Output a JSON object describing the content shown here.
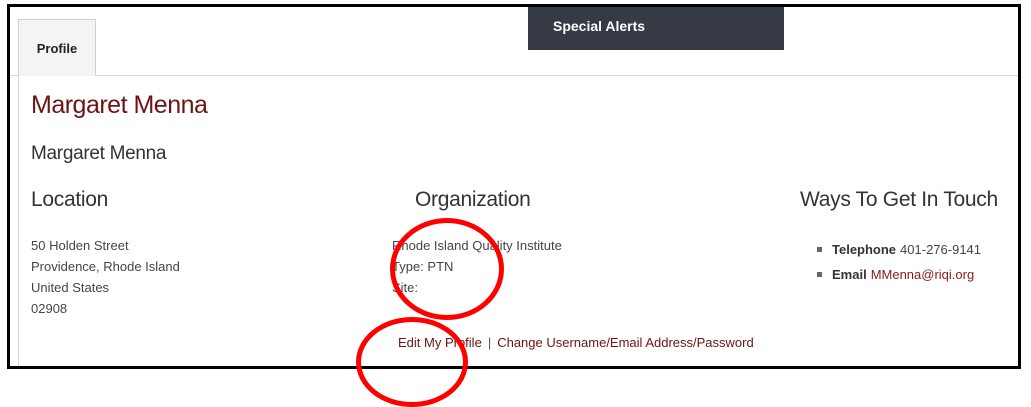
{
  "tabs": [
    {
      "label": "Profile"
    }
  ],
  "alerts": {
    "label": "Special Alerts"
  },
  "profile": {
    "title": "Margaret Menna",
    "subname": "Margaret Menna"
  },
  "location": {
    "heading": "Location",
    "lines": [
      "50 Holden Street",
      "Providence, Rhode Island",
      "United States",
      "02908"
    ]
  },
  "organization": {
    "heading": "Organization",
    "name": "Rhode Island Quality Institute",
    "type": "Type: PTN",
    "site": "Site:"
  },
  "contact": {
    "heading": "Ways To Get In Touch",
    "telephone_label": "Telephone",
    "telephone_value": "401-276-9141",
    "email_label": "Email",
    "email_value": "MMenna@riqi.org"
  },
  "footer": {
    "edit_profile": "Edit My Profile",
    "separator": "|",
    "change_credentials": "Change Username/Email Address/Password"
  },
  "colors": {
    "title": "#6d1313",
    "alert_bar": "#353a45",
    "annotation": "#ff0000"
  }
}
